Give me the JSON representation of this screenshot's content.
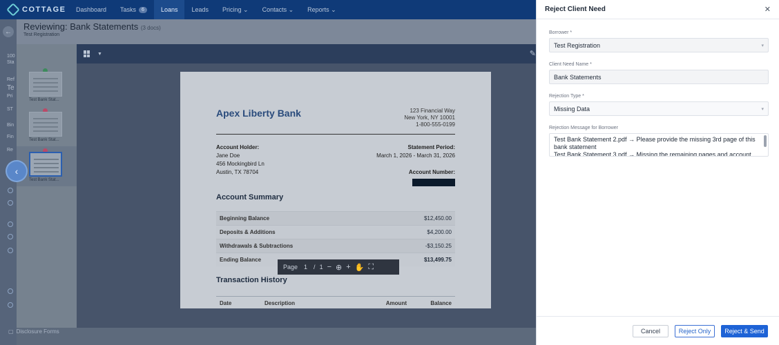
{
  "nav": {
    "brand": "COTTAGE",
    "items": [
      {
        "label": "Dashboard"
      },
      {
        "label": "Tasks",
        "badge": "6"
      },
      {
        "label": "Loans"
      },
      {
        "label": "Leads"
      },
      {
        "label": "Pricing ⌄"
      },
      {
        "label": "Contacts ⌄"
      },
      {
        "label": "Reports ⌄"
      }
    ]
  },
  "left_strip": {
    "fragments": [
      "100",
      "Sta",
      "Ref",
      "Te",
      "Pri",
      "ST",
      "Bin",
      "Fin",
      "Re"
    ],
    "disclosure": "Disclosure Forms"
  },
  "reviewer": {
    "title": "Reviewing: Bank Statements",
    "doc_count": "(3 docs)",
    "subtitle": "Test Registration",
    "thumbnails": [
      {
        "label": "Test Bank Stat...",
        "status": "ok"
      },
      {
        "label": "Test Bank Stat...",
        "status": "rejected"
      },
      {
        "label": "Test Bank Stat...",
        "status": "rejected"
      }
    ],
    "pager": {
      "label": "Page",
      "current": "1",
      "sep": "/",
      "total": "1"
    }
  },
  "document": {
    "bank_name": "Apex Liberty Bank",
    "bank_address": [
      "123 Financial Way",
      "New York, NY 10001",
      "1-800-555-0199"
    ],
    "holder_label": "Account Holder:",
    "holder": [
      "Jane Doe",
      "456 Mockingbird Ln",
      "Austin, TX 78704"
    ],
    "period_label": "Statement Period:",
    "period": "March 1, 2026 - March 31, 2026",
    "account_label": "Account Number:",
    "summary_title": "Account Summary",
    "summary": [
      {
        "label": "Beginning Balance",
        "value": "$12,450.00"
      },
      {
        "label": "Deposits & Additions",
        "value": "$4,200.00"
      },
      {
        "label": "Withdrawals & Subtractions",
        "value": "-$3,150.25"
      },
      {
        "label": "Ending Balance",
        "value": "$13,499.75"
      }
    ],
    "history_title": "Transaction History",
    "history_cols": [
      "Date",
      "Description",
      "Amount",
      "Balance"
    ]
  },
  "drawer": {
    "title": "Reject Client Need",
    "borrower_label": "Borrower *",
    "borrower_value": "Test Registration",
    "need_label": "Client Need Name *",
    "need_value": "Bank Statements",
    "type_label": "Rejection Type *",
    "type_value": "Missing Data",
    "message_label": "Rejection Message for Borrower",
    "message_lines": [
      "Test Bank Statement 2.pdf → Please provide the missing 3rd page of this",
      "bank statement",
      "Test Bank Statement 3.pdf → Missing the remaining pages and account"
    ],
    "cancel": "Cancel",
    "reject_only": "Reject Only",
    "reject_send": "Reject & Send"
  },
  "colors": {
    "nav_bg": "#0f3a78",
    "primary": "#1e63d6",
    "rejected_mark": "#b94a68",
    "ok_mark": "#3d8a5d"
  }
}
